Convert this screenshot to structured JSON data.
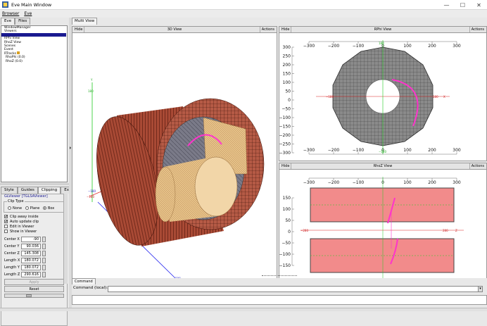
{
  "window": {
    "title": "Eve Main Window",
    "minimize": "—",
    "maximize": "☐",
    "close": "✕"
  },
  "menu": [
    "Browser",
    "Eve"
  ],
  "left": {
    "tabs": [
      "Eve",
      "Files"
    ],
    "tree": [
      "WindowManager",
      "Viewers",
      "",
      "RPhi View",
      "RhoZ View",
      "Scenes",
      "Event",
      "RTracks",
      "RhoPhi (0.0)",
      "RhoZ (0.0)"
    ],
    "editor_tabs": [
      "Style",
      "Guides",
      "Clipping",
      "Extras"
    ],
    "viewer_name": "GLViewer [TGLSAViewer]",
    "clip_type_label": "Clip Type",
    "clip_options": [
      "None",
      "Plane",
      "Box"
    ],
    "checkboxes": [
      {
        "label": "Clip away inside",
        "checked": true
      },
      {
        "label": "Auto update clip",
        "checked": true
      },
      {
        "label": "Edit in Viewer",
        "checked": false
      },
      {
        "label": "Show in Viewer",
        "checked": false
      }
    ],
    "fields": [
      {
        "label": "Center X",
        "value": "-90"
      },
      {
        "label": "Center Y",
        "value": "90.036"
      },
      {
        "label": "Center Z",
        "value": "145.308"
      },
      {
        "label": "Length X",
        "value": "180.072"
      },
      {
        "label": "Length Y",
        "value": "180.072"
      },
      {
        "label": "Length Z",
        "value": "290.616"
      }
    ],
    "apply": "Apply",
    "reset": "Reset"
  },
  "main": {
    "tab": "Multi View",
    "views": [
      {
        "title": "3D View",
        "hide": "Hide",
        "actions": "Actions"
      },
      {
        "title": "RPhi View",
        "hide": "Hide",
        "actions": "Actions"
      },
      {
        "title": "RhoZ View",
        "hide": "Hide",
        "actions": "Actions"
      }
    ],
    "axis_ticks": [
      "−300",
      "−200",
      "−100",
      "0",
      "100",
      "200",
      "300"
    ],
    "y_ticks_rphi": [
      "300",
      "250",
      "200",
      "150",
      "100",
      "50",
      "0",
      "−50",
      "−100",
      "−150",
      "−200",
      "−250",
      "−300"
    ],
    "y_ticks_rhoz": [
      "150",
      "100",
      "50",
      "0",
      "−50",
      "−100",
      "−150"
    ],
    "rphi_labels": {
      "x_neg": "−180",
      "x_pos": "180",
      "x_axis": "X",
      "y_pos": "180",
      "y_neg": "−180"
    },
    "rhoz_labels": {
      "z_neg": "−280",
      "z_pos": "280",
      "z_axis": "Z"
    },
    "axis3d": {
      "y": "180",
      "ny": "−180",
      "x": "−180",
      "z": "280",
      "zl": "Z",
      "yl": "Y"
    }
  },
  "command": {
    "tab": "Command",
    "label": "Command (local):",
    "value": ""
  },
  "colors": {
    "calo_red": "#a94a35",
    "track_magenta": "#ff33cc",
    "rhoz_fill": "#f28b8b"
  }
}
